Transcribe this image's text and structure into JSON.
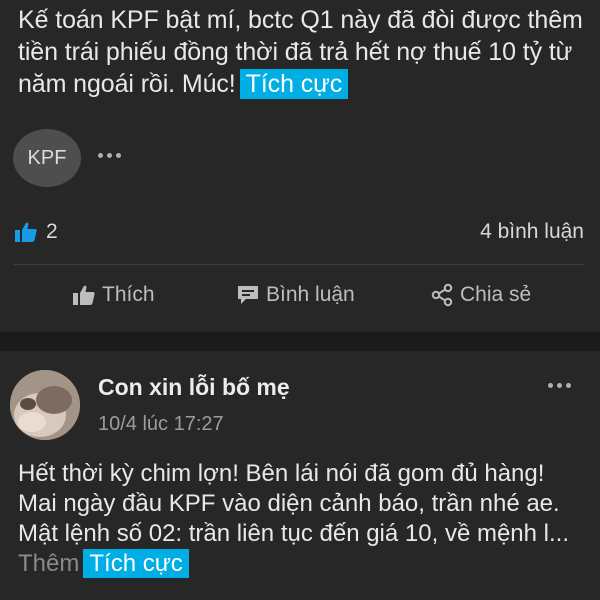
{
  "post1": {
    "text": "Kế toán KPF bật mí, bctc Q1 này đã đòi được thêm tiền trái phiếu đồng thời đã trả hết nợ thuế 10 tỷ từ năm ngoái rồi. Múc!",
    "sentiment_tag": "Tích cực",
    "avatar_text": "KPF",
    "like_count": "2",
    "comment_count": "4 bình luận",
    "actions": {
      "like": "Thích",
      "comment": "Bình luận",
      "share": "Chia sẻ"
    }
  },
  "post2": {
    "author": "Con xin lỗi bố mẹ",
    "timestamp": "10/4 lúc 17:27",
    "text_line1": "Hết thời kỳ chim lợn! Bên lái nói đã gom đủ hàng!",
    "text_line2": "Mai ngày đầu KPF vào diện cảnh báo, trần nhé ae. Mật lệnh số 02: trần liên tục đến giá 10, về mệnh l...",
    "more_label": "Thêm",
    "sentiment_tag": "Tích cực"
  },
  "colors": {
    "accent": "#00aee6",
    "like_blue": "#1a9be6",
    "card_bg": "#272727",
    "page_bg": "#1b1b1b"
  }
}
